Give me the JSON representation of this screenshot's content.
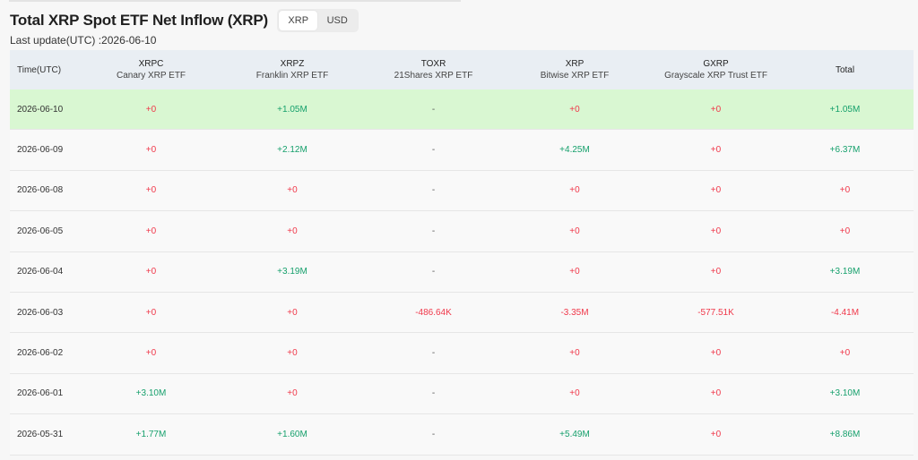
{
  "title": "Total XRP Spot ETF Net Inflow (XRP)",
  "toggle": {
    "xrp_label": "XRP",
    "usd_label": "USD",
    "active": "XRP"
  },
  "last_update": "Last update(UTC) :2026-06-10",
  "colors": {
    "positive": "#16a06c",
    "negative": "#f0384a",
    "highlight_row": "#d9f7d2",
    "header_bg": "#e9eef3"
  },
  "table": {
    "time_header": "Time(UTC)",
    "columns": [
      {
        "ticker": "XRPC",
        "name": "Canary XRP ETF"
      },
      {
        "ticker": "XRPZ",
        "name": "Franklin XRP ETF"
      },
      {
        "ticker": "TOXR",
        "name": "21Shares XRP ETF"
      },
      {
        "ticker": "XRP",
        "name": "Bitwise XRP ETF"
      },
      {
        "ticker": "GXRP",
        "name": "Grayscale XRP Trust ETF"
      },
      {
        "ticker": "Total",
        "name": ""
      }
    ],
    "rows": [
      {
        "date": "2026-06-10",
        "values": [
          "+0",
          "+1.05M",
          "-",
          "+0",
          "+0",
          "+1.05M"
        ]
      },
      {
        "date": "2026-06-09",
        "values": [
          "+0",
          "+2.12M",
          "-",
          "+4.25M",
          "+0",
          "+6.37M"
        ]
      },
      {
        "date": "2026-06-08",
        "values": [
          "+0",
          "+0",
          "-",
          "+0",
          "+0",
          "+0"
        ]
      },
      {
        "date": "2026-06-05",
        "values": [
          "+0",
          "+0",
          "-",
          "+0",
          "+0",
          "+0"
        ]
      },
      {
        "date": "2026-06-04",
        "values": [
          "+0",
          "+3.19M",
          "-",
          "+0",
          "+0",
          "+3.19M"
        ]
      },
      {
        "date": "2026-06-03",
        "values": [
          "+0",
          "+0",
          "-486.64K",
          "-3.35M",
          "-577.51K",
          "-4.41M"
        ]
      },
      {
        "date": "2026-06-02",
        "values": [
          "+0",
          "+0",
          "-",
          "+0",
          "+0",
          "+0"
        ]
      },
      {
        "date": "2026-06-01",
        "values": [
          "+3.10M",
          "+0",
          "-",
          "+0",
          "+0",
          "+3.10M"
        ]
      },
      {
        "date": "2026-05-31",
        "values": [
          "+1.77M",
          "+1.60M",
          "-",
          "+5.49M",
          "+0",
          "+8.86M"
        ]
      }
    ]
  }
}
